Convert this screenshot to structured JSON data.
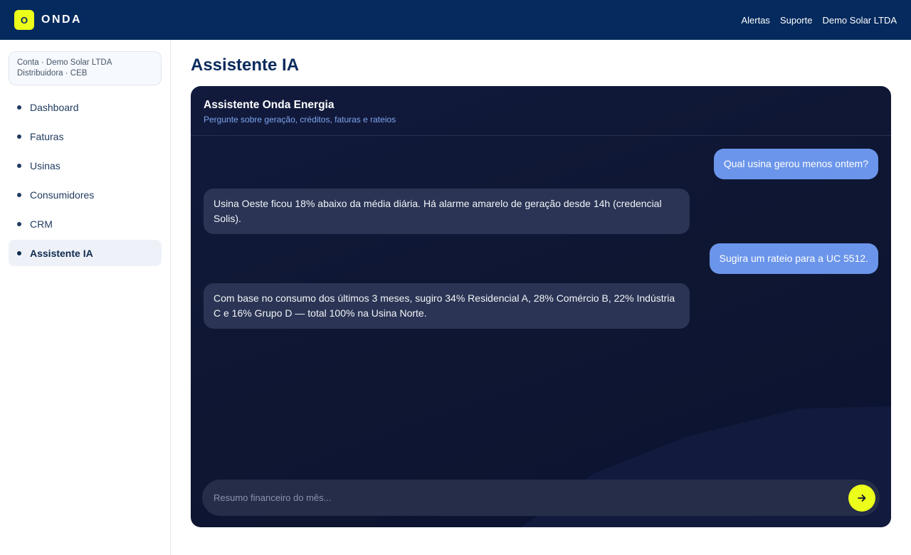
{
  "topbar": {
    "logo_letter": "O",
    "brand": "ONDA",
    "links": [
      "Alertas",
      "Suporte",
      "Demo Solar LTDA"
    ]
  },
  "sidebar": {
    "account_line1": "Conta · Demo Solar LTDA",
    "account_line2": "Distribuidora · CEB",
    "items": [
      {
        "label": "Dashboard"
      },
      {
        "label": "Faturas"
      },
      {
        "label": "Usinas"
      },
      {
        "label": "Consumidores"
      },
      {
        "label": "CRM"
      },
      {
        "label": "Assistente IA"
      }
    ],
    "active_item": "Assistente IA"
  },
  "page": {
    "title": "Assistente IA"
  },
  "chat": {
    "title": "Assistente Onda Energia",
    "subtitle": "Pergunte sobre geração, créditos, faturas e rateios",
    "messages": [
      {
        "role": "user",
        "text": "Qual usina gerou menos ontem?"
      },
      {
        "role": "assistant",
        "text": "Usina Oeste ficou 18% abaixo da média diária. Há alarme amarelo de geração desde 14h (credencial Solis)."
      },
      {
        "role": "user",
        "text": "Sugira um rateio para a UC 5512."
      },
      {
        "role": "assistant",
        "text": "Com base no consumo dos últimos 3 meses, sugiro 34% Residencial A, 28% Comércio B, 22% Indústria C e 16% Grupo D — total 100% na Usina Norte."
      }
    ],
    "input_value": "",
    "input_placeholder": "Resumo financeiro do mês...",
    "send_icon": "arrow-right-icon"
  },
  "colors": {
    "topbar": "#052a5e",
    "accent": "#ecff1a",
    "chat_bg": "#0e1632",
    "user_bubble": "#6b95ea",
    "assistant_bubble": "#2b3454"
  }
}
